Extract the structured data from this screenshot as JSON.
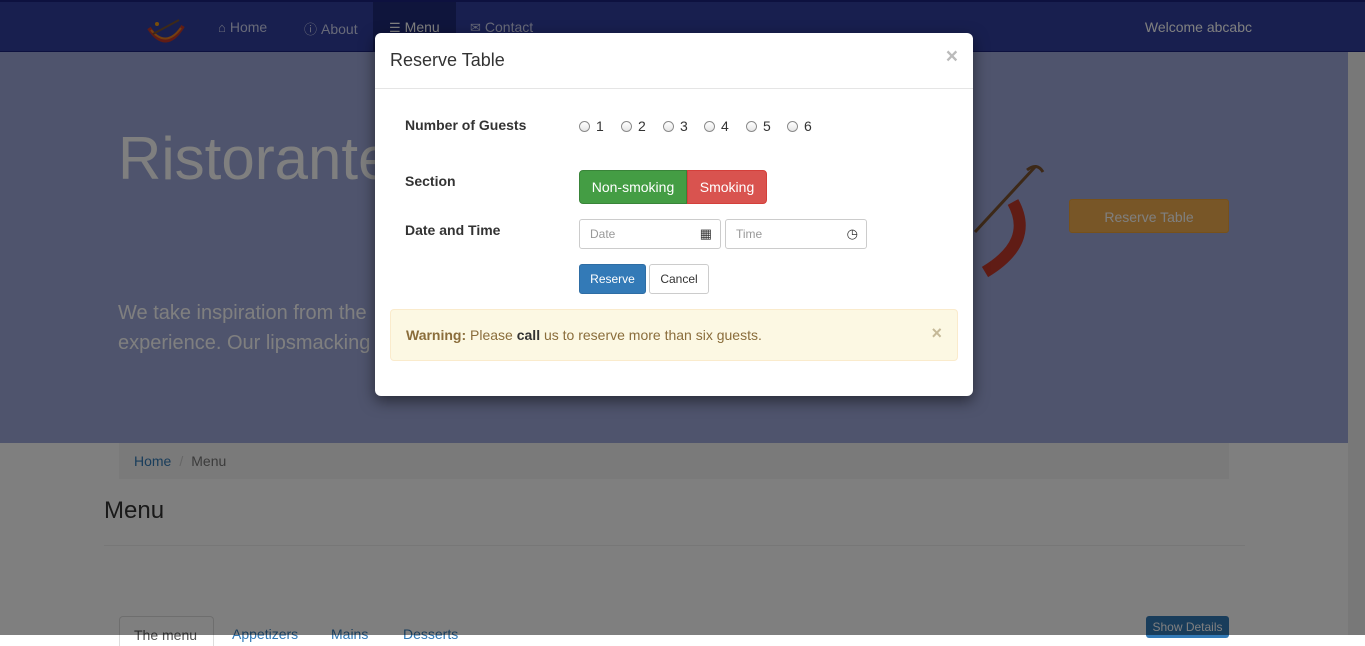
{
  "navbar": {
    "items": [
      {
        "label": "Home",
        "icon": "home-icon"
      },
      {
        "label": "About",
        "icon": "info-icon"
      },
      {
        "label": "Menu",
        "icon": "list-icon"
      },
      {
        "label": "Contact",
        "icon": "envelope-icon"
      }
    ],
    "welcome": "Welcome abcabc"
  },
  "jumbotron": {
    "title": "Ristorante",
    "text_line1": "We take inspiration from the",
    "text_line2": "experience. Our lipsmacking",
    "reserve_button": "Reserve Table"
  },
  "breadcrumb": {
    "home": "Home",
    "separator": "/",
    "current": "Menu"
  },
  "page": {
    "heading": "Menu",
    "tabs": [
      "The menu",
      "Appetizers",
      "Mains",
      "Desserts"
    ],
    "show_details": "Show Details"
  },
  "modal": {
    "title": "Reserve Table",
    "close": "×",
    "guests_label": "Number of Guests",
    "guest_options": [
      "1",
      "2",
      "3",
      "4",
      "5",
      "6"
    ],
    "section_label": "Section",
    "section_options": {
      "non_smoking": "Non-smoking",
      "smoking": "Smoking"
    },
    "datetime_label": "Date and Time",
    "date_placeholder": "Date",
    "time_placeholder": "Time",
    "reserve_button": "Reserve",
    "cancel_button": "Cancel",
    "alert": {
      "strong": "Warning:",
      "text1": "Please",
      "bold": "call",
      "text2": "us to reserve more than six guests.",
      "close": "×"
    }
  },
  "colors": {
    "navbar": "#303F9F",
    "jumbotron": "#9fa8da",
    "primary": "#337ab7",
    "success": "#449d44",
    "danger": "#d9534f",
    "warning_bg": "#fcf8e3"
  }
}
